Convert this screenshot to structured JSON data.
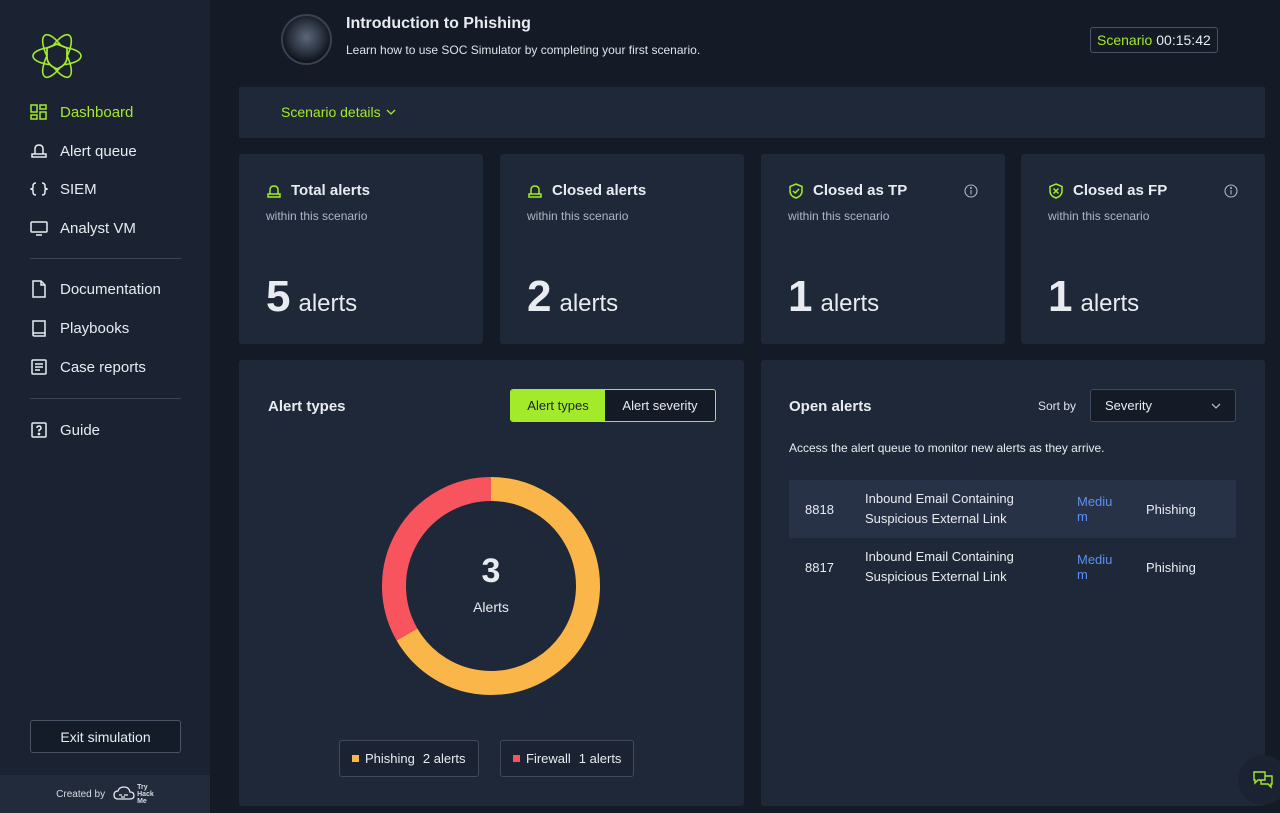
{
  "sidebar": {
    "items": [
      {
        "label": "Dashboard",
        "icon": "dashboard-icon",
        "active": true
      },
      {
        "label": "Alert queue",
        "icon": "alert-queue-icon"
      },
      {
        "label": "SIEM",
        "icon": "braces-icon"
      },
      {
        "label": "Analyst VM",
        "icon": "monitor-icon"
      },
      {
        "label": "Documentation",
        "icon": "document-icon"
      },
      {
        "label": "Playbooks",
        "icon": "book-icon"
      },
      {
        "label": "Case reports",
        "icon": "report-icon"
      },
      {
        "label": "Guide",
        "icon": "help-icon"
      }
    ],
    "exit_label": "Exit simulation",
    "created_by": "Created by",
    "brand_lines": [
      "Try",
      "Hack",
      "Me"
    ]
  },
  "header": {
    "title": "Introduction to Phishing",
    "subtitle": "Learn how to use SOC Simulator by completing your first scenario.",
    "timer_label": "Scenario",
    "timer_value": "00:15:42",
    "details_link": "Scenario details"
  },
  "stats": [
    {
      "title": "Total alerts",
      "sub": "within this scenario",
      "value": "5",
      "unit": "alerts",
      "icon": "alert-icon",
      "info": false
    },
    {
      "title": "Closed alerts",
      "sub": "within this scenario",
      "value": "2",
      "unit": "alerts",
      "icon": "alert-icon",
      "info": false
    },
    {
      "title": "Closed as TP",
      "sub": "within this scenario",
      "value": "1",
      "unit": "alerts",
      "icon": "shield-check-icon",
      "info": true
    },
    {
      "title": "Closed as FP",
      "sub": "within this scenario",
      "value": "1",
      "unit": "alerts",
      "icon": "shield-x-icon",
      "info": true
    }
  ],
  "alert_types": {
    "title": "Alert types",
    "toggle": [
      "Alert types",
      "Alert severity"
    ],
    "center_value": "3",
    "center_label": "Alerts",
    "legend": [
      {
        "name": "Phishing",
        "count": "2 alerts",
        "color": "#fbb649"
      },
      {
        "name": "Firewall",
        "count": "1 alerts",
        "color": "#f8545e"
      }
    ]
  },
  "chart_data": {
    "type": "pie",
    "categories": [
      "Phishing",
      "Firewall"
    ],
    "values": [
      2,
      1
    ],
    "colors": [
      "#fbb649",
      "#f8545e"
    ]
  },
  "open_alerts": {
    "title": "Open alerts",
    "sort_label": "Sort by",
    "sort_value": "Severity",
    "description": "Access the alert queue to monitor new alerts as they arrive.",
    "rows": [
      {
        "id": "8818",
        "title": "Inbound Email Containing Suspicious External Link",
        "severity": "Medium",
        "type": "Phishing"
      },
      {
        "id": "8817",
        "title": "Inbound Email Containing Suspicious External Link",
        "severity": "Medium",
        "type": "Phishing"
      }
    ]
  },
  "colors": {
    "accent": "#a3ea2a",
    "severity_medium": "#5d8ff0"
  }
}
